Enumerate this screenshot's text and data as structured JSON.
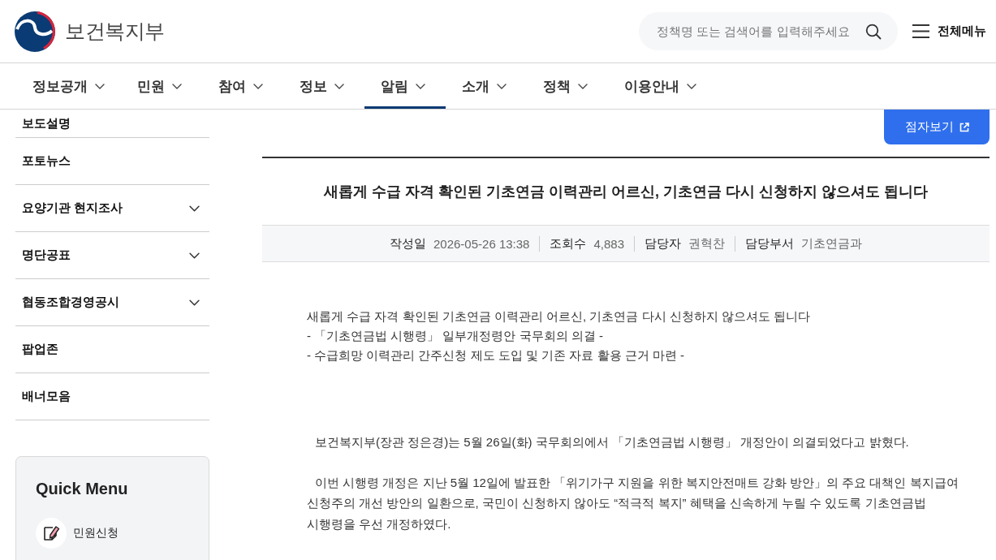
{
  "header": {
    "logo_text": "보건복지부",
    "search": {
      "placeholder": "정책명 또는 검색어를 입력해주세요"
    },
    "all_menu": "전체메뉴"
  },
  "nav": [
    {
      "label": "정보공개",
      "selected": false
    },
    {
      "label": "민원",
      "selected": false
    },
    {
      "label": "참여",
      "selected": false
    },
    {
      "label": "정보",
      "selected": false
    },
    {
      "label": "알림",
      "selected": true
    },
    {
      "label": "소개",
      "selected": false
    },
    {
      "label": "정책",
      "selected": false
    },
    {
      "label": "이용안내",
      "selected": false
    }
  ],
  "sidebar": {
    "items": [
      {
        "label": "보도설명",
        "expandable": false
      },
      {
        "label": "포토뉴스",
        "expandable": false
      },
      {
        "label": "요양기관 현지조사",
        "expandable": true
      },
      {
        "label": "명단공표",
        "expandable": true
      },
      {
        "label": "협동조합경영공시",
        "expandable": true
      },
      {
        "label": "팝업존",
        "expandable": false
      },
      {
        "label": "배너모음",
        "expandable": false
      }
    ],
    "quick_menu": {
      "title": "Quick Menu",
      "items": [
        {
          "label": "민원신청"
        }
      ]
    }
  },
  "article": {
    "braille_button": "점자보기",
    "title": "새롭게 수급 자격 확인된 기초연금 이력관리 어르신, 기초연금 다시 신청하지 않으셔도 됩니다",
    "meta": [
      {
        "label": "작성일",
        "value": "2026-05-26 13:38"
      },
      {
        "label": "조회수",
        "value": "4,883"
      },
      {
        "label": "담당자",
        "value": "권혁찬"
      },
      {
        "label": "담당부서",
        "value": "기초연금과"
      }
    ],
    "summary": [
      "새롭게 수급 자격 확인된 기초연금 이력관리 어르신, 기초연금 다시 신청하지 않으셔도 됩니다",
      "- 「기초연금법 시행령」 일부개정령안 국무회의 의결 -",
      "- 수급희망 이력관리 간주신청 제도 도입 및 기존 자료 활용 근거 마련 -"
    ],
    "paragraphs": [
      "보건복지부(장관 정은경)는 5월 26일(화) 국무회의에서 「기초연금법 시행령」 개정안이 의결되었다고 밝혔다.",
      "이번 시행령 개정은 지난 5월 12일에 발표한 「위기가구 지원을 위한 복지안전매트 강화 방안」의 주요 대책인 복지급여 신청주의 개선 방안의 일환으로, 국민이 신청하지 않아도 “적극적 복지” 혜택을 신속하게 누릴 수 있도록 기초연금법 시행령을 우선 개정하였다."
    ]
  }
}
